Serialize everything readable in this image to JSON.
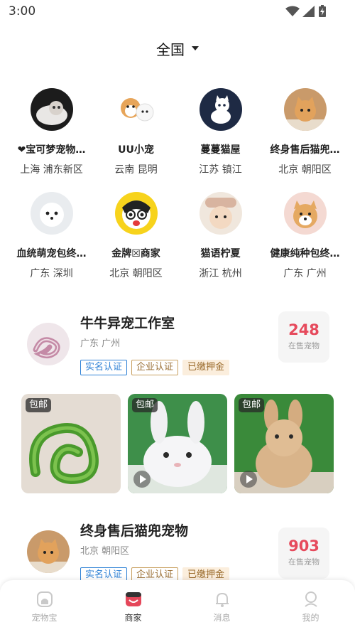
{
  "status": {
    "time": "3:00"
  },
  "region": {
    "title": "全国"
  },
  "shops": [
    {
      "name": "❤宝可梦宠物…",
      "location": "上海 浦东新区"
    },
    {
      "name": "UU小宠",
      "location": "云南 昆明"
    },
    {
      "name": "蔓蔓猫屋",
      "location": "江苏 镇江"
    },
    {
      "name": "终身售后猫兜…",
      "location": "北京 朝阳区"
    },
    {
      "name": "血统萌宠包终…",
      "location": "广东 深圳"
    },
    {
      "name": "金牌☒商家",
      "location": "北京 朝阳区"
    },
    {
      "name": "猫语柠夏",
      "location": "浙江 杭州"
    },
    {
      "name": "健康纯种包终…",
      "location": "广东 广州"
    }
  ],
  "merchants": [
    {
      "name": "牛牛异宠工作室",
      "location": "广东 广州",
      "tags": [
        "实名认证",
        "企业认证",
        "已缴押金"
      ],
      "count": "248",
      "count_label": "在售宠物",
      "photos": [
        {
          "badge": "包邮",
          "icon": "snake"
        },
        {
          "badge": "包邮",
          "icon": "rabbit-white",
          "video": true
        },
        {
          "badge": "包邮",
          "icon": "rabbit-brown",
          "video": true
        }
      ]
    },
    {
      "name": "终身售后猫兜宠物",
      "location": "北京 朝阳区",
      "tags": [
        "实名认证",
        "企业认证",
        "已缴押金"
      ],
      "count": "903",
      "count_label": "在售宠物"
    }
  ],
  "nav": [
    {
      "label": "宠物宝",
      "icon": "home-icon"
    },
    {
      "label": "商家",
      "icon": "shop-icon",
      "active": true
    },
    {
      "label": "消息",
      "icon": "bell-icon"
    },
    {
      "label": "我的",
      "icon": "profile-icon"
    }
  ],
  "colors": {
    "accent": "#e64a5c",
    "tag_blue": "#2f82d6",
    "tag_gold": "#c8a060"
  }
}
